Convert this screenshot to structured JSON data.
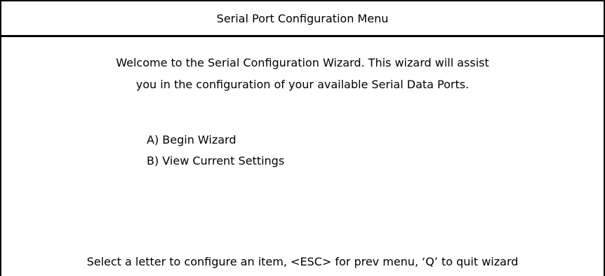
{
  "window": {
    "title": "Serial Port Configuration Menu"
  },
  "welcome": {
    "line1": "Welcome to the Serial Configuration Wizard. This wizard will assist",
    "line2": "you in the configuration of your available Serial Data Ports."
  },
  "menu": {
    "items": [
      {
        "key": "A",
        "label": "A) Begin Wizard"
      },
      {
        "key": "B",
        "label": "B) View Current Settings"
      }
    ]
  },
  "footer": {
    "instructions": "Select a letter to configure an item, <ESC> for prev menu, ‘Q’ to quit wizard"
  }
}
